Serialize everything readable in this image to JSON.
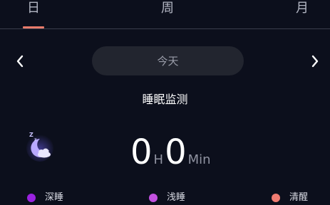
{
  "tabs": [
    {
      "label": "日",
      "active": true
    },
    {
      "label": "周",
      "active": false
    },
    {
      "label": "月",
      "active": false
    }
  ],
  "date_selector": {
    "value": "今天"
  },
  "section_title": "睡眠监测",
  "duration": {
    "hours": "0",
    "hours_unit": "H",
    "minutes": "0",
    "minutes_unit": "Min"
  },
  "legend": [
    {
      "label": "深睡",
      "color": "#9a22e0"
    },
    {
      "label": "浅睡",
      "color": "#c351e0"
    },
    {
      "label": "清醒",
      "color": "#f07c72"
    }
  ],
  "colors": {
    "background": "#0c0f1c",
    "tab_indicator": "#e87b6b",
    "pill_background": "#22252f"
  }
}
